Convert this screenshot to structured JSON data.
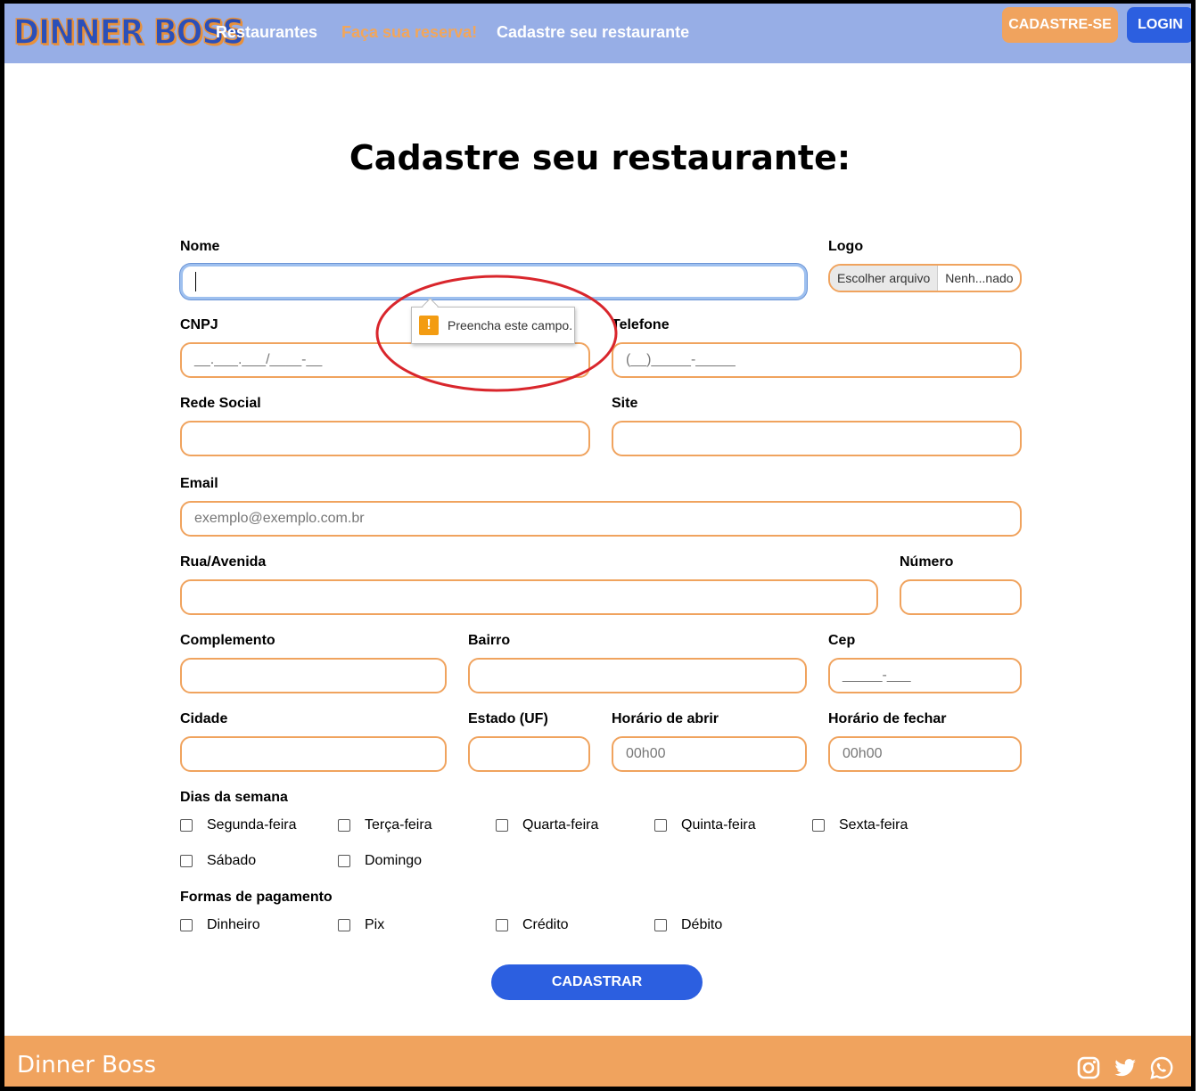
{
  "nav": {
    "brand": "DINNER BOSS",
    "links": [
      "Restaurantes",
      "Faça sua reserva!",
      "Cadastre seu restaurante"
    ],
    "signup": "CADASTRE-SE",
    "login": "LOGIN"
  },
  "title": "Cadastre seu restaurante:",
  "fields": {
    "nome": {
      "label": "Nome",
      "value": ""
    },
    "logo": {
      "label": "Logo",
      "button": "Escolher arquivo",
      "file": "Nenh...nado"
    },
    "cnpj": {
      "label": "CNPJ",
      "placeholder": "__.___.___/____-__"
    },
    "telefone": {
      "label": "Telefone",
      "placeholder": "(__)_____-_____"
    },
    "rede_social": {
      "label": "Rede Social"
    },
    "site": {
      "label": "Site"
    },
    "email": {
      "label": "Email",
      "placeholder": "exemplo@exemplo.com.br"
    },
    "rua": {
      "label": "Rua/Avenida"
    },
    "numero": {
      "label": "Número"
    },
    "complemento": {
      "label": "Complemento"
    },
    "bairro": {
      "label": "Bairro"
    },
    "cep": {
      "label": "Cep",
      "placeholder": "_____-___"
    },
    "cidade": {
      "label": "Cidade"
    },
    "estado": {
      "label": "Estado (UF)"
    },
    "abrir": {
      "label": "Horário de abrir",
      "placeholder": "00h00"
    },
    "fechar": {
      "label": "Horário de fechar",
      "placeholder": "00h00"
    }
  },
  "tooltip": "Preencha este campo.",
  "dias": {
    "label": "Dias da semana",
    "items": [
      "Segunda-feira",
      "Terça-feira",
      "Quarta-feira",
      "Quinta-feira",
      "Sexta-feira",
      "Sábado",
      "Domingo"
    ]
  },
  "pagamento": {
    "label": "Formas de pagamento",
    "items": [
      "Dinheiro",
      "Pix",
      "Crédito",
      "Débito"
    ]
  },
  "submit": "CADASTRAR",
  "footer": {
    "brand": "Dinner Boss"
  },
  "colors": {
    "nav": "#97aee6",
    "accent": "#f0a35e",
    "primary": "#2c5fe0"
  },
  "icons": [
    "instagram-icon",
    "twitter-icon",
    "whatsapp-icon"
  ]
}
